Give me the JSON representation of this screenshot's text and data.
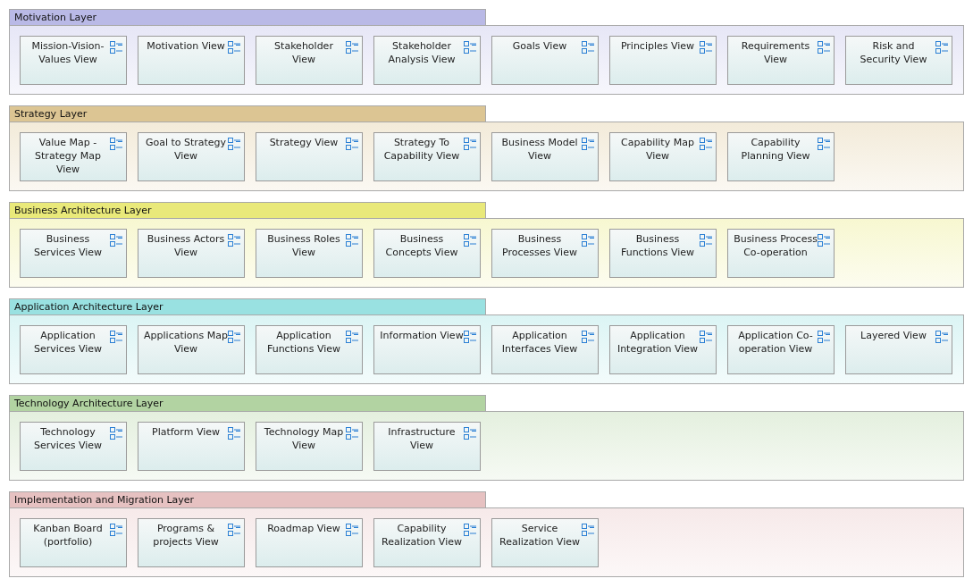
{
  "layers": [
    {
      "title": "Motivation Layer",
      "color": "#b9b9e6",
      "views": [
        "Mission-Vision-Values View",
        "Motivation View",
        "Stakeholder View",
        "Stakeholder Analysis View",
        "Goals View",
        "Principles View",
        "Requirements View",
        "Risk and Security View"
      ]
    },
    {
      "title": "Strategy Layer",
      "color": "#dcc593",
      "views": [
        "Value Map - Strategy Map View",
        "Goal to Strategy View",
        "Strategy View",
        "Strategy To Capability View",
        "Business Model View",
        "Capability Map View",
        "Capability Planning View"
      ]
    },
    {
      "title": "Business Architecture Layer",
      "color": "#e9e97a",
      "views": [
        "Business Services View",
        "Business Actors View",
        "Business Roles View",
        "Business Concepts View",
        "Business Processes View",
        "Business Functions View",
        "Business Process Co-operation"
      ]
    },
    {
      "title": "Application Architecture Layer",
      "color": "#99e1e1",
      "views": [
        "Application Services View",
        "Applications Map View",
        "Application Functions View",
        "Information View",
        "Application Interfaces View",
        "Application Integration View",
        "Application Co-operation View",
        "Layered View"
      ]
    },
    {
      "title": "Technology Architecture Layer",
      "color": "#b2d3a2",
      "views": [
        "Technology Services View",
        "Platform View",
        "Technology Map View",
        "Infrastructure View"
      ]
    },
    {
      "title": "Implementation and Migration Layer",
      "color": "#e6c1c1",
      "views": [
        "Kanban Board (portfolio)",
        "Programs & projects View",
        "Roadmap View",
        "Capability Realization View",
        "Service Realization View"
      ]
    }
  ]
}
